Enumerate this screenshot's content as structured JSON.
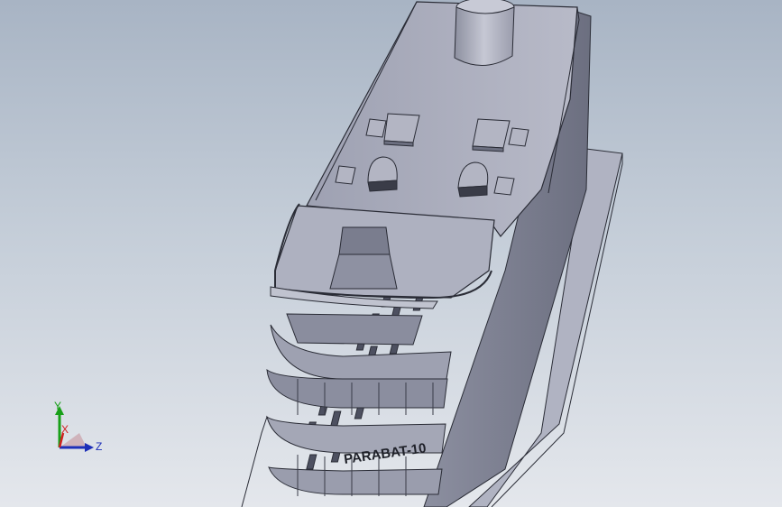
{
  "model": {
    "hull_name": "PARABAT-10"
  },
  "triad": {
    "axis_y": "Y",
    "axis_x": "X",
    "axis_z": "Z"
  },
  "colors": {
    "bg_top": "#a8b4c4",
    "bg_bottom": "#e4e7ec",
    "model_fill": "#a9acbc",
    "model_light": "#c4c6d2",
    "model_dark": "#5e6172",
    "edge": "#2a2c36",
    "axis_x": "#d02020",
    "axis_y": "#18a018",
    "axis_z": "#1d2fb8"
  },
  "icons": {
    "view_triad": "coordinate-triad-icon"
  }
}
